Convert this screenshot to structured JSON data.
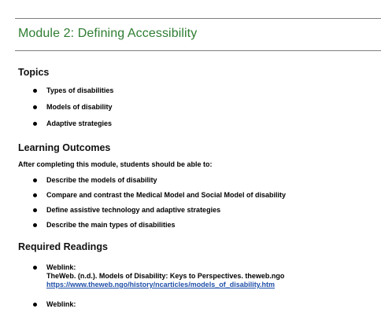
{
  "module": {
    "title": "Module 2: Defining Accessibility"
  },
  "topics": {
    "heading": "Topics",
    "items": [
      "Types of disabilities",
      "Models of disability",
      "Adaptive strategies"
    ]
  },
  "outcomes": {
    "heading": "Learning Outcomes",
    "intro": "After completing this module, students should be able to:",
    "items": [
      "Describe the models of disability",
      "Compare and contrast the Medical Model and Social Model of disability",
      "Define assistive technology and adaptive strategies",
      "Describe the main types of disabilities"
    ]
  },
  "readings": {
    "heading": "Required Readings",
    "items": [
      {
        "label": "Weblink:",
        "reference": "TheWeb. (n.d.). Models of Disability: Keys to Perspectives. theweb.ngo",
        "url": "https://www.theweb.ngo/history/ncarticles/models_of_disability.htm"
      },
      {
        "label": "Weblink:"
      }
    ]
  }
}
